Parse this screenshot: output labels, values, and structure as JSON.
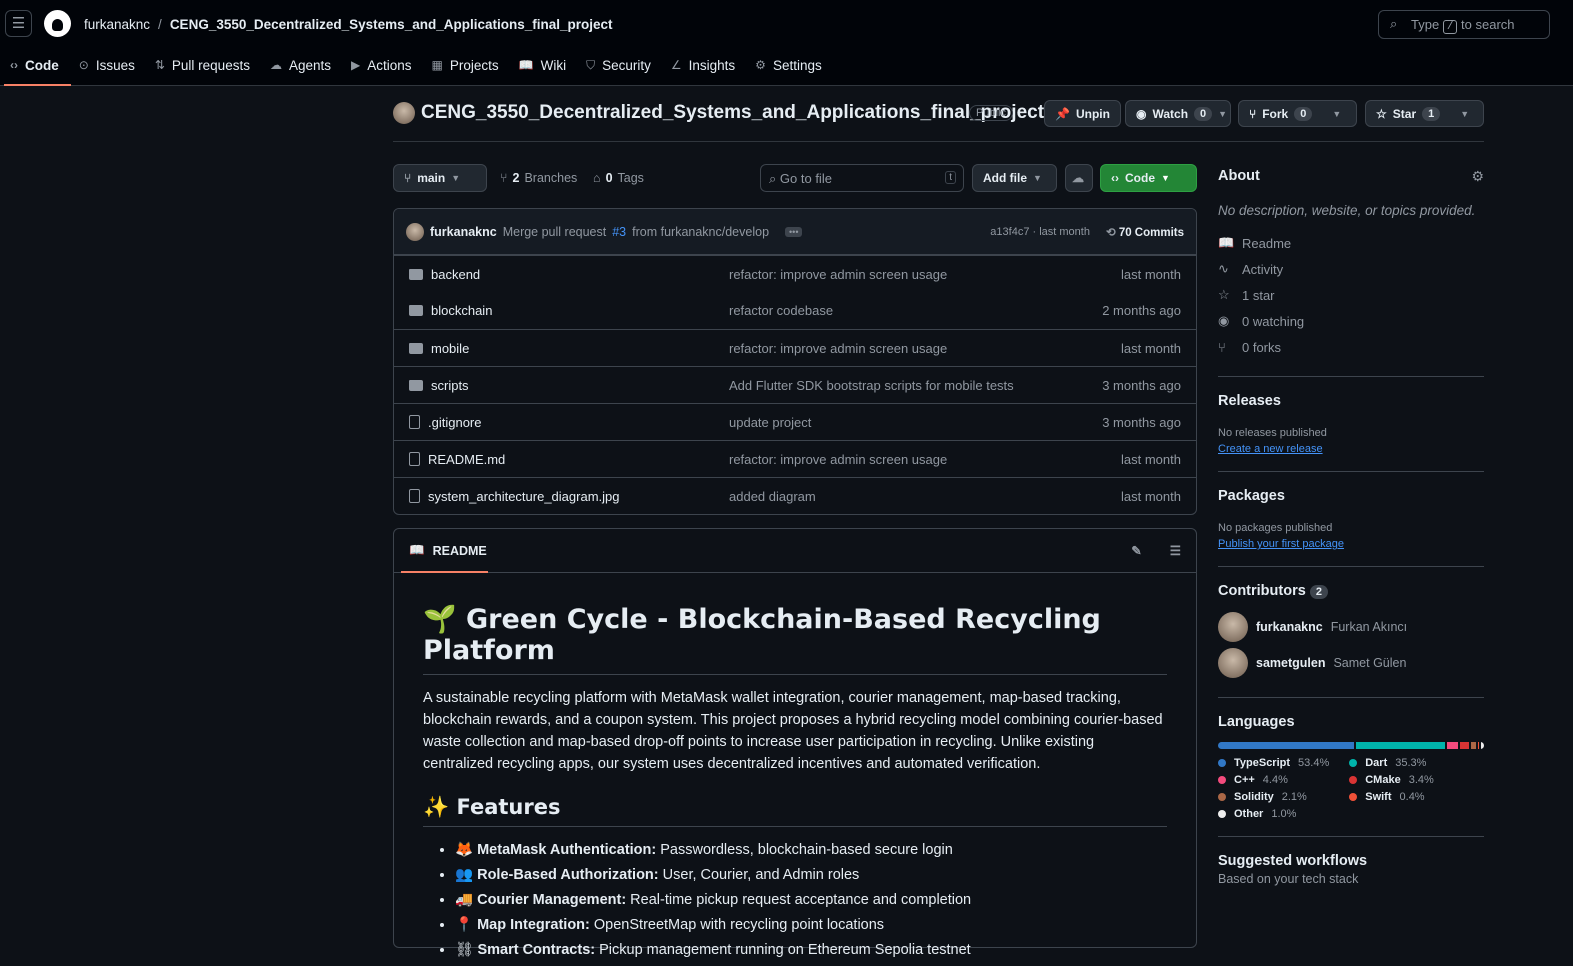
{
  "header": {
    "owner": "furkanaknc",
    "repo": "CENG_3550_Decentralized_Systems_and_Applications_final_project",
    "search_prefix": "Type",
    "search_key": "/",
    "search_suffix": "to search"
  },
  "nav": [
    {
      "label": "Code",
      "icon": "‹›"
    },
    {
      "label": "Issues",
      "icon": "⊙"
    },
    {
      "label": "Pull requests",
      "icon": "⇅"
    },
    {
      "label": "Agents",
      "icon": "☁"
    },
    {
      "label": "Actions",
      "icon": "▶"
    },
    {
      "label": "Projects",
      "icon": "▦"
    },
    {
      "label": "Wiki",
      "icon": "📖"
    },
    {
      "label": "Security",
      "icon": "⛉"
    },
    {
      "label": "Insights",
      "icon": "∠"
    },
    {
      "label": "Settings",
      "icon": "⚙"
    }
  ],
  "repo": {
    "title": "CENG_3550_Decentralized_Systems_and_Applications_final_project",
    "visibility": "Public",
    "unpin": "Unpin",
    "watch": "Watch",
    "watch_count": "0",
    "fork": "Fork",
    "fork_count": "0",
    "star": "Star",
    "star_count": "1"
  },
  "toolbar": {
    "branch": "main",
    "branches_count": "2",
    "branches": "Branches",
    "tags_count": "0",
    "tags": "Tags",
    "goto_placeholder": "Go to file",
    "goto_key": "t",
    "add_file": "Add file",
    "code": "Code"
  },
  "commit": {
    "author": "furkanaknc",
    "msg_prefix": "Merge pull request",
    "pr": "#3",
    "msg_suffix": "from furkanaknc/develop",
    "sha": "a13f4c7 · last month",
    "commits": "70 Commits"
  },
  "files": [
    {
      "name": "backend",
      "type": "dir",
      "msg": "refactor: improve admin screen usage",
      "time": "last month"
    },
    {
      "name": "blockchain",
      "type": "dir",
      "msg": "refactor codebase",
      "time": "2 months ago"
    },
    {
      "name": "mobile",
      "type": "dir",
      "msg": "refactor: improve admin screen usage",
      "time": "last month"
    },
    {
      "name": "scripts",
      "type": "dir",
      "msg": "Add Flutter SDK bootstrap scripts for mobile tests",
      "time": "3 months ago"
    },
    {
      "name": ".gitignore",
      "type": "file",
      "msg": "update project",
      "time": "3 months ago"
    },
    {
      "name": "README.md",
      "type": "file",
      "msg": "refactor: improve admin screen usage",
      "time": "last month"
    },
    {
      "name": "system_architecture_diagram.jpg",
      "type": "file",
      "msg": "added diagram",
      "time": "last month"
    }
  ],
  "readme": {
    "tab": "README",
    "title": "🌱 Green Cycle - Blockchain-Based Recycling Platform",
    "intro": "A sustainable recycling platform with MetaMask wallet integration, courier management, map-based tracking, blockchain rewards, and a coupon system. This project proposes a hybrid recycling model combining courier-based waste collection and map-based drop-off points to increase user participation in recycling. Unlike existing centralized recycling apps, our system uses decentralized incentives and automated verification.",
    "features_title": "✨ Features",
    "features": [
      {
        "emoji": "🦊",
        "bold": "MetaMask Authentication:",
        "text": " Passwordless, blockchain-based secure login"
      },
      {
        "emoji": "👥",
        "bold": "Role-Based Authorization:",
        "text": " User, Courier, and Admin roles"
      },
      {
        "emoji": "🚚",
        "bold": "Courier Management:",
        "text": " Real-time pickup request acceptance and completion"
      },
      {
        "emoji": "📍",
        "bold": "Map Integration:",
        "text": " OpenStreetMap with recycling point locations"
      },
      {
        "emoji": "⛓",
        "bold": "Smart Contracts:",
        "text": " Pickup management running on Ethereum Sepolia testnet"
      }
    ]
  },
  "about": {
    "title": "About",
    "desc": "No description, website, or topics provided.",
    "items": [
      {
        "icon": "📖",
        "label": "Readme"
      },
      {
        "icon": "∿",
        "label": "Activity"
      },
      {
        "icon": "☆",
        "label": "1 star"
      },
      {
        "icon": "◉",
        "label": "0 watching"
      },
      {
        "icon": "⑂",
        "label": "0 forks"
      }
    ]
  },
  "releases": {
    "title": "Releases",
    "none": "No releases published",
    "link": "Create a new release"
  },
  "packages": {
    "title": "Packages",
    "none": "No packages published",
    "link": "Publish your first package"
  },
  "contributors": {
    "title": "Contributors",
    "count": "2",
    "list": [
      {
        "login": "furkanaknc",
        "name": "Furkan Akıncı"
      },
      {
        "login": "sametgulen",
        "name": "Samet Gülen"
      }
    ]
  },
  "languages": {
    "title": "Languages",
    "list": [
      {
        "name": "TypeScript",
        "pct": 53.4,
        "pct_label": "53.4%",
        "color": "#3178c6"
      },
      {
        "name": "Dart",
        "pct": 35.3,
        "pct_label": "35.3%",
        "color": "#00b4ab"
      },
      {
        "name": "C++",
        "pct": 4.4,
        "pct_label": "4.4%",
        "color": "#f34b7d"
      },
      {
        "name": "CMake",
        "pct": 3.4,
        "pct_label": "3.4%",
        "color": "#da3434"
      },
      {
        "name": "Solidity",
        "pct": 2.1,
        "pct_label": "2.1%",
        "color": "#aa6746"
      },
      {
        "name": "Swift",
        "pct": 0.4,
        "pct_label": "0.4%",
        "color": "#f05138"
      },
      {
        "name": "Other",
        "pct": 1.0,
        "pct_label": "1.0%",
        "color": "#ededed"
      }
    ]
  },
  "workflows": {
    "title": "Suggested workflows",
    "sub": "Based on your tech stack"
  }
}
